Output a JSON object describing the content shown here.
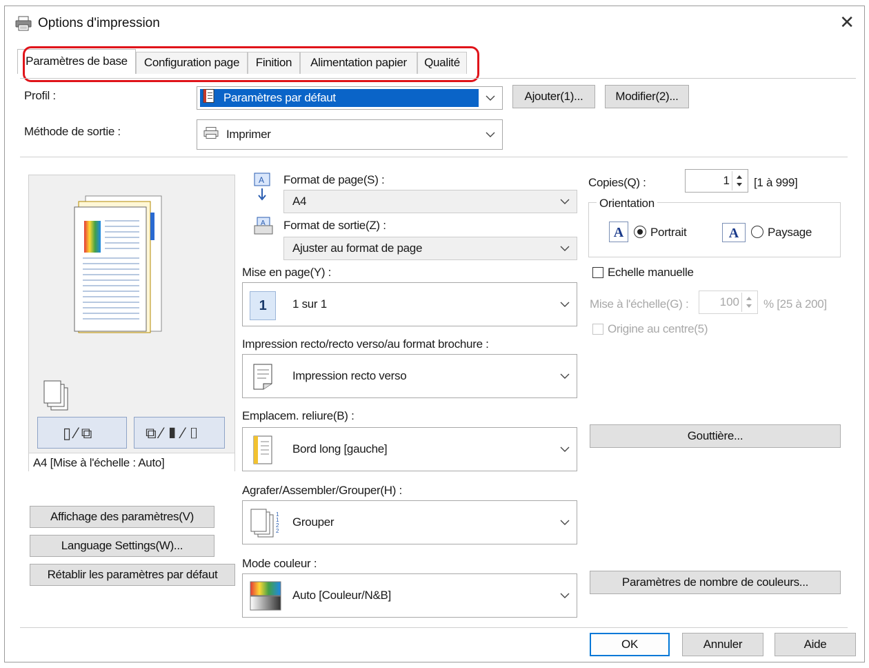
{
  "window": {
    "title": "Options d'impression",
    "close_glyph": "✕"
  },
  "tabs": [
    {
      "label": "Paramètres de base",
      "active": true
    },
    {
      "label": "Configuration page",
      "active": false
    },
    {
      "label": "Finition",
      "active": false
    },
    {
      "label": "Alimentation papier",
      "active": false
    },
    {
      "label": "Qualité",
      "active": false
    }
  ],
  "profile": {
    "label": "Profil :",
    "value": "Paramètres par défaut",
    "add_button": "Ajouter(1)...",
    "edit_button": "Modifier(2)..."
  },
  "output_method": {
    "label": "Méthode de sortie :",
    "value": "Imprimer"
  },
  "page_size": {
    "label": "Format de page(S) :",
    "value": "A4"
  },
  "output_size": {
    "label": "Format de sortie(Z) :",
    "value": "Ajuster au format de page"
  },
  "layout": {
    "label": "Mise en page(Y) :",
    "value": "1 sur 1",
    "badge": "1"
  },
  "duplex": {
    "label": "Impression recto/recto verso/au format brochure :",
    "value": "Impression recto verso"
  },
  "binding": {
    "label": "Emplacem. reliure(B) :",
    "value": "Bord long [gauche]"
  },
  "staple": {
    "label": "Agrafer/Assembler/Grouper(H) :",
    "value": "Grouper"
  },
  "color_mode": {
    "label": "Mode couleur :",
    "value": "Auto [Couleur/N&B]"
  },
  "copies": {
    "label": "Copies(Q) :",
    "value": "1",
    "range": "[1 à 999]"
  },
  "orientation": {
    "label": "Orientation",
    "portrait": "Portrait",
    "landscape": "Paysage",
    "icon_letter": "A",
    "selected": "portrait"
  },
  "manual_scale": {
    "label": "Echelle manuelle",
    "checked": false
  },
  "scaling": {
    "label": "Mise à l'échelle(G) :",
    "value": "100",
    "range": "% [25 à 200]"
  },
  "center_origin": {
    "label": "Origine au centre(5)",
    "checked": false
  },
  "gutter_button": "Gouttière...",
  "color_count_button": "Paramètres de nombre de couleurs...",
  "preview": {
    "caption": "A4 [Mise à l'échelle : Auto]"
  },
  "left_buttons": {
    "view_settings": "Affichage des paramètres(V)",
    "language": "Language Settings(W)...",
    "restore": "Rétablir les paramètres par défaut"
  },
  "footer": {
    "ok": "OK",
    "cancel": "Annuler",
    "help": "Aide"
  },
  "colors": {
    "accent": "#0078d7",
    "highlight": "#e0141a",
    "selection": "#0a64c8"
  }
}
